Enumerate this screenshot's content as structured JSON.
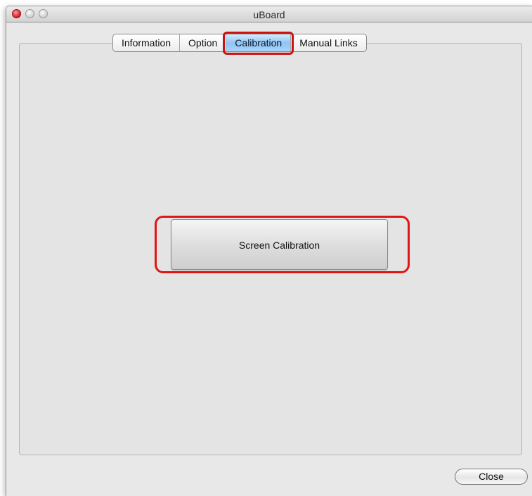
{
  "window": {
    "title": "uBoard"
  },
  "tabs": [
    {
      "label": "Information",
      "active": false
    },
    {
      "label": "Option",
      "active": false
    },
    {
      "label": "Calibration",
      "active": true
    },
    {
      "label": "Manual Links",
      "active": false
    }
  ],
  "main": {
    "calibration_button_label": "Screen Calibration"
  },
  "footer": {
    "close_label": "Close"
  },
  "colors": {
    "highlight": "#e01616",
    "active_tab": "#8fc4f4"
  }
}
